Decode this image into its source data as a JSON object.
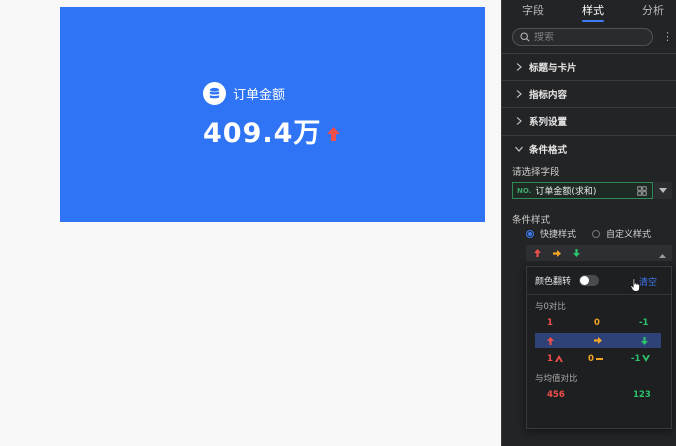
{
  "card": {
    "title": "订单金额",
    "value": "409.4万",
    "icon": "database-icon",
    "trend": "up",
    "bg_color": "#2f74f5",
    "up_color": "#f0504a"
  },
  "panel": {
    "tabs": [
      {
        "label": "字段",
        "active": false
      },
      {
        "label": "样式",
        "active": true
      },
      {
        "label": "分析",
        "active": false
      }
    ],
    "search_placeholder": "搜索",
    "sections": [
      {
        "label": "标题与卡片",
        "expanded": false
      },
      {
        "label": "指标内容",
        "expanded": false
      },
      {
        "label": "系列设置",
        "expanded": false
      },
      {
        "label": "条件格式",
        "expanded": true
      }
    ],
    "condition": {
      "field_label": "请选择字段",
      "field_type": "NO.",
      "field_value": "订单金额(求和)",
      "style_label": "条件样式",
      "radio_quick": "快捷样式",
      "radio_custom": "自定义样式",
      "selected_style": "quick"
    }
  },
  "popover": {
    "reverse_label": "颜色翻转",
    "reverse_on": false,
    "clear_label": "清空",
    "group1_label": "与0对比",
    "row_numbers": [
      "1",
      "0",
      "-1"
    ],
    "row_tri": [
      "1",
      "0",
      "-1"
    ],
    "group2_label": "与均值对比",
    "row_avg": [
      "456",
      "123"
    ],
    "colors": {
      "up": "#f0504a",
      "flat": "#f5a623",
      "down": "#2bc36b",
      "accent": "#3f7bf5"
    }
  }
}
